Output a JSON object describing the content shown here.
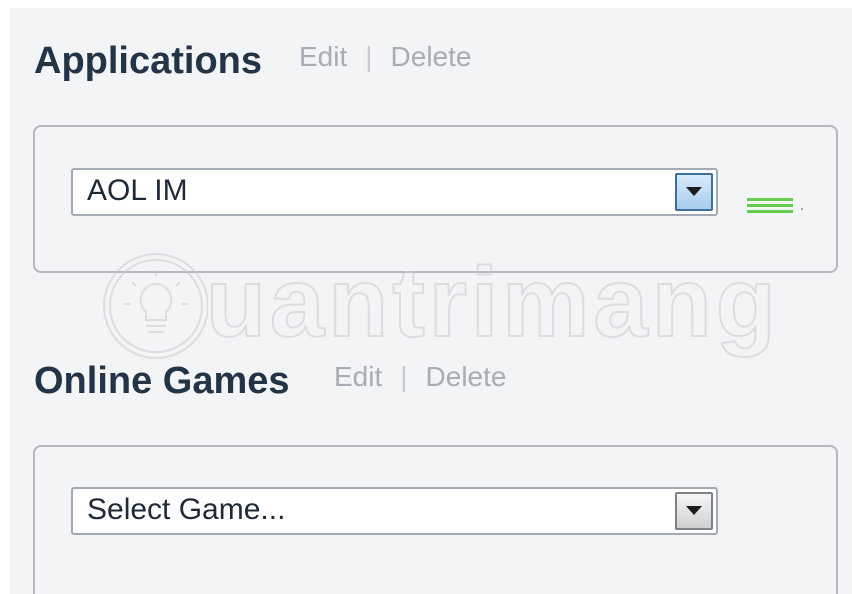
{
  "applications": {
    "title": "Applications",
    "edit_label": "Edit",
    "separator": "|",
    "delete_label": "Delete",
    "select_value": "AOL IM"
  },
  "online_games": {
    "title": "Online Games",
    "edit_label": "Edit",
    "separator": "|",
    "delete_label": "Delete",
    "select_value": "Select Game..."
  },
  "watermark": {
    "text": "uantrimang"
  },
  "icons": {
    "dropdown": "chevron-down-icon",
    "drag_handle": "drag-handle-icon",
    "watermark_logo": "lightbulb-logo-icon"
  },
  "colors": {
    "background": "#f3f4f6",
    "title": "#243447",
    "link": "#a7adb5",
    "active_dropdown": "#a8cdee",
    "handle": "#65cc4d"
  }
}
